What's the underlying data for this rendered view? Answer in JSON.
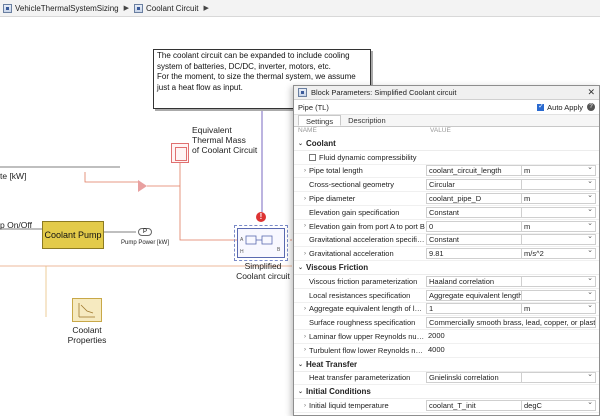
{
  "breadcrumb": {
    "root": "VehicleThermalSystemSizing",
    "child": "Coolant Circuit",
    "sep": "▶"
  },
  "canvas": {
    "note_lines": [
      "The coolant circuit can be expanded to include cooling",
      "system of batteries, DC/DC, inverter, motors, etc.",
      "For the moment, to size the thermal system, we assume",
      "just a heat flow as input."
    ],
    "heat_label": "te [kW]",
    "pump_onoff_label": "p On/Off",
    "coolant_pump": "Coolant Pump",
    "pump_power_label": "Pump Power [kW]",
    "thermal_mass_label": [
      "Equivalent",
      "Thermal Mass",
      "of Coolant Circuit"
    ],
    "simplified_label": [
      "Simplified",
      "Coolant circuit"
    ],
    "coolant_properties_label": [
      "Coolant",
      "Properties"
    ],
    "port_labels": {
      "a": "A",
      "b": "B",
      "h": "H"
    },
    "warning_glyph": "!",
    "pump_power_glyph": "P"
  },
  "dialog": {
    "title": "Block Parameters: Simplified Coolant circuit",
    "close": "✕",
    "subtitle": "Pipe (TL)",
    "auto_apply": "Auto Apply",
    "help": "?",
    "tabs": [
      "Settings",
      "Description"
    ],
    "col_name": "NAME",
    "col_value": "VALUE",
    "sections": {
      "coolant": "Coolant",
      "coolant_flag": "Fluid dynamic compressibility",
      "coolant_rows": [
        {
          "name": "Pipe total length",
          "value": "coolant_circuit_length",
          "unit": "m",
          "expand": true
        },
        {
          "name": "Cross-sectional geometry",
          "value": "Circular",
          "unit": "",
          "expand": false
        },
        {
          "name": "Pipe diameter",
          "value": "coolant_pipe_D",
          "unit": "m",
          "expand": true
        },
        {
          "name": "Elevation gain specification",
          "value": "Constant",
          "unit": "",
          "expand": false
        },
        {
          "name": "Elevation gain from port A to port B",
          "value": "0",
          "unit": "m",
          "expand": true
        },
        {
          "name": "Gravitational acceleration specification",
          "value": "Constant",
          "unit": "",
          "expand": false
        },
        {
          "name": "Gravitational acceleration",
          "value": "9.81",
          "unit": "m/s^2",
          "expand": true
        }
      ],
      "viscous": "Viscous Friction",
      "viscous_rows": [
        {
          "name": "Viscous friction parameterization",
          "value": "Haaland correlation",
          "unit": "",
          "expand": false
        },
        {
          "name": "Local resistances specification",
          "value": "Aggregate equivalent length",
          "unit": "",
          "expand": false
        },
        {
          "name": "Aggregate equivalent length of local ...",
          "value": "1",
          "unit": "m",
          "expand": true
        },
        {
          "name": "Surface roughness specification",
          "value": "Commercially smooth brass, lead, copper, or plastic pip",
          "unit": "",
          "expand": false,
          "long": true
        },
        {
          "name": "Laminar flow upper Reynolds number...",
          "value": "2000",
          "unit": "",
          "expand": true,
          "plain": true
        },
        {
          "name": "Turbulent flow lower Reynolds numb...",
          "value": "4000",
          "unit": "",
          "expand": true,
          "plain": true
        }
      ],
      "heat": "Heat Transfer",
      "heat_rows": [
        {
          "name": "Heat transfer parameterization",
          "value": "Gnielinski correlation",
          "unit": "",
          "expand": false
        }
      ],
      "initial": "Initial Conditions",
      "initial_rows": [
        {
          "name": "Initial liquid temperature",
          "value": "coolant_T_init",
          "unit": "degC",
          "expand": true
        }
      ]
    }
  },
  "colors": {
    "accent": "#2a6ad0",
    "pump": "#e3cb4a",
    "signal_line": "#e07a5f",
    "thermal_line": "#7a6ac0"
  }
}
